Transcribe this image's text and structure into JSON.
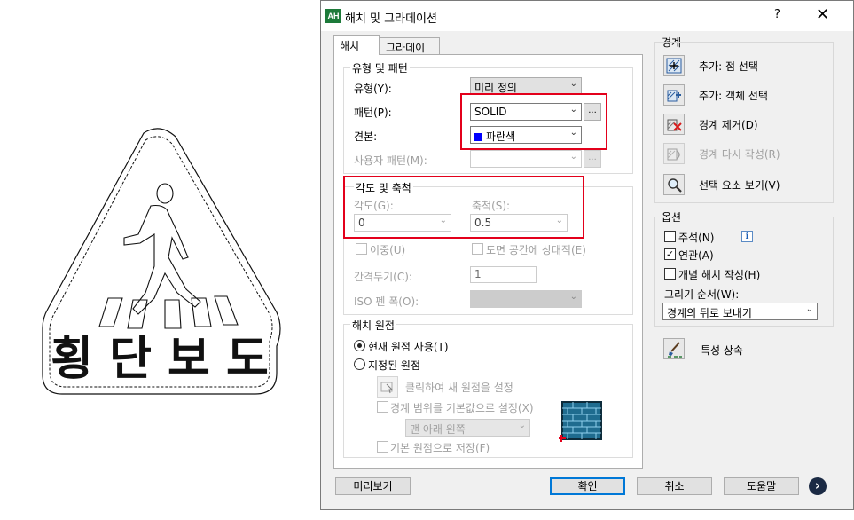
{
  "drawing": {
    "sign_text": "횡 단 보 도"
  },
  "dialog": {
    "title": "해치 및 그라데이션",
    "help": "?",
    "close": "✕",
    "app_icon_text": "AH"
  },
  "tabs": [
    {
      "label": "해치",
      "active": true
    },
    {
      "label": "그라데이션",
      "active": false
    }
  ],
  "type_pattern": {
    "group_title": "유형 및 패턴",
    "type_label": "유형(Y):",
    "type_value": "미리 정의",
    "pattern_label": "패턴(P):",
    "pattern_value": "SOLID",
    "browse": "...",
    "swatch_label": "견본:",
    "swatch_value": "파란색",
    "swatch_color": "#0000ff",
    "custom_label": "사용자 패턴(M):",
    "custom_browse": "..."
  },
  "angle_scale": {
    "group_title": "각도 및 축척",
    "angle_label": "각도(G):",
    "angle_value": "0",
    "scale_label": "축척(S):",
    "scale_value": "0.5",
    "double_label": "이중(U)",
    "paper_space_label": "도면 공간에 상대적(E)",
    "spacing_label": "간격두기(C):",
    "spacing_value": "1",
    "iso_label": "ISO 펜 폭(O):"
  },
  "origin": {
    "group_title": "해치 원점",
    "current_label": "현재 원점 사용(T)",
    "specified_label": "지정된 원점",
    "click_label": "클릭하여 새 원점을 설정",
    "default_extents_label": "경계 범위를 기본값으로 설정(X)",
    "position_value": "맨 아래 왼쪽",
    "store_label": "기본 원점으로 저장(F)"
  },
  "boundaries": {
    "title": "경계",
    "pick_points": "추가: 점 선택",
    "select_objects": "추가: 객체 선택",
    "remove": "경계 제거(D)",
    "recreate": "경계 다시 작성(R)",
    "view_selections": "선택 요소 보기(V)"
  },
  "options": {
    "title": "옵션",
    "annotative": "주석(N)",
    "associative": "연관(A)",
    "separate": "개별 해치 작성(H)",
    "draw_order_label": "그리기 순서(W):",
    "draw_order_value": "경계의 뒤로 보내기",
    "info": "i"
  },
  "inherit": {
    "label": "특성 상속"
  },
  "footer": {
    "preview": "미리보기",
    "ok": "확인",
    "cancel": "취소",
    "help": "도움말",
    "more": "›"
  }
}
